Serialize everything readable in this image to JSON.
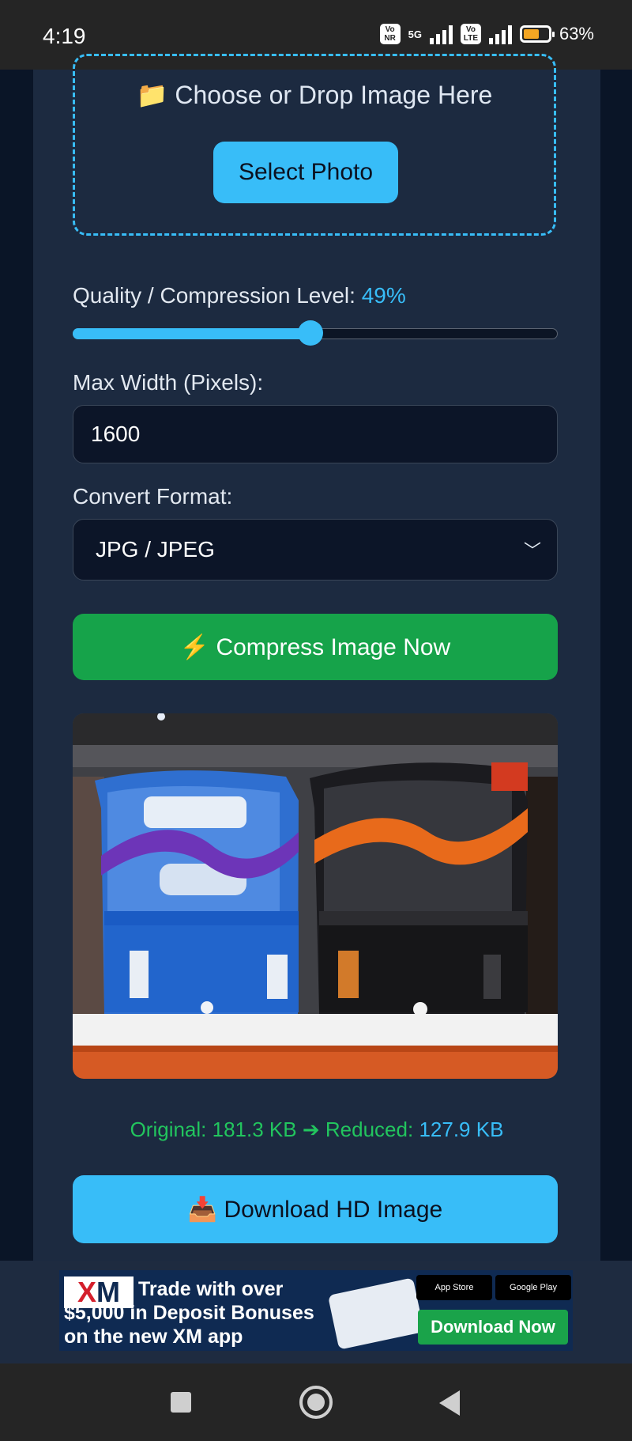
{
  "status_bar": {
    "time": "4:19",
    "sim1": "Vo NR",
    "network": "5G",
    "sim2": "Vo LTE",
    "battery": "63%",
    "battery_level": 0.63
  },
  "upload": {
    "prompt_icon": "folder-icon",
    "prompt": "📁 Choose or Drop Image Here",
    "select_label": "Select Photo"
  },
  "quality": {
    "label": "Quality / Compression Level:",
    "value_text": "49%",
    "value": 49
  },
  "max_width": {
    "label": "Max Width (Pixels):",
    "value": "1600"
  },
  "format": {
    "label": "Convert Format:",
    "selected": "JPG / JPEG"
  },
  "compress_label": "⚡ Compress Image Now",
  "stats": {
    "original_label": "Original:",
    "original_value": "181.3 KB",
    "arrow": "➔",
    "reduced_label": "Reduced:",
    "reduced_value": "127.9 KB"
  },
  "download_label": "📥 Download HD Image",
  "ad": {
    "logo_x": "X",
    "logo_m": "M",
    "line1": "Trade with over",
    "line2": "$5,000 in Deposit Bonuses",
    "line3": "on the new XM app",
    "app_store": "App Store",
    "google_play": "Google Play",
    "cta": "Download Now"
  },
  "colors": {
    "accent": "#38bdf8",
    "success": "#16a34a",
    "stats_green": "#22c55e",
    "card": "#1c2a40",
    "background": "#0a1527"
  }
}
